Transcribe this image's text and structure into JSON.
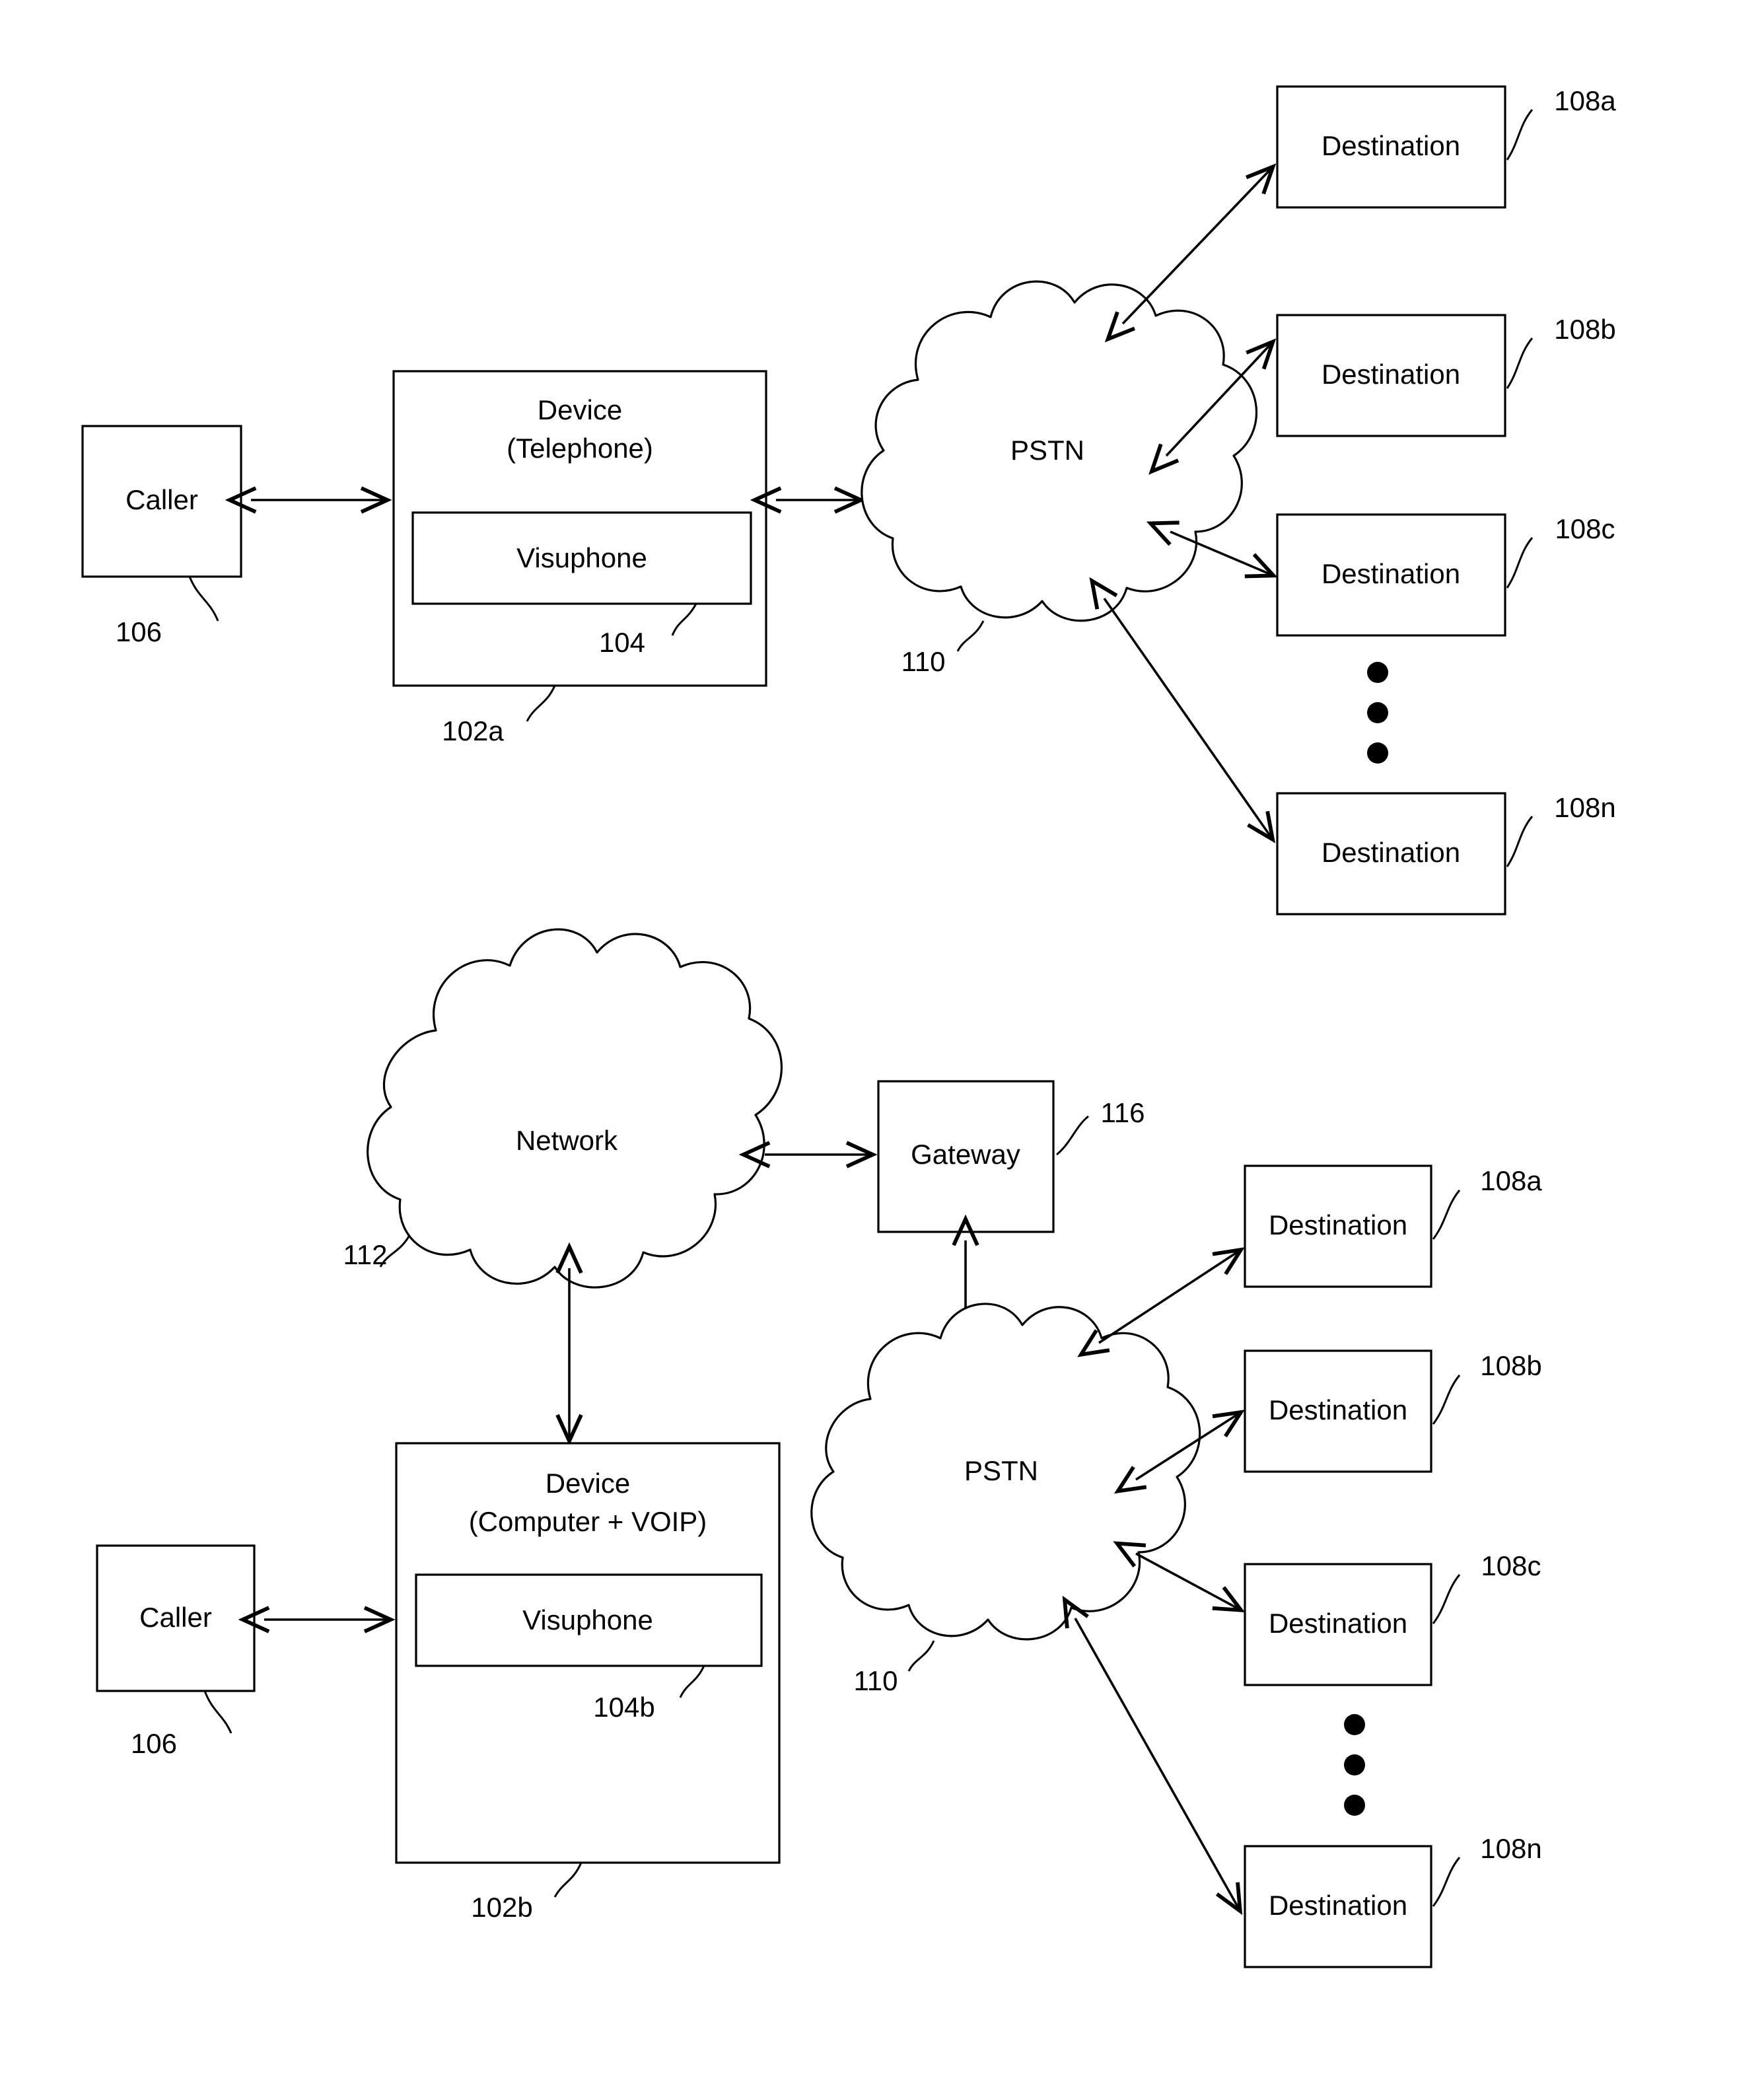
{
  "figure": {
    "type": "patent-diagram",
    "title": "Visuphone call routing system block diagrams",
    "panels": [
      {
        "id": "upper-panel",
        "nodes": {
          "caller": {
            "label": "Caller",
            "ref": "106"
          },
          "device": {
            "label_line1": "Device",
            "label_line2": "(Telephone)",
            "ref": "102a"
          },
          "visuphone": {
            "label": "Visuphone",
            "ref": "104"
          },
          "pstn": {
            "label": "PSTN",
            "ref": "110"
          },
          "destinations": [
            {
              "label": "Destination",
              "ref": "108a"
            },
            {
              "label": "Destination",
              "ref": "108b"
            },
            {
              "label": "Destination",
              "ref": "108c"
            },
            {
              "label": "Destination",
              "ref": "108n"
            }
          ],
          "ellipsis": "vertical-three-dots"
        }
      },
      {
        "id": "lower-panel",
        "nodes": {
          "caller": {
            "label": "Caller",
            "ref": "106"
          },
          "device": {
            "label_line1": "Device",
            "label_line2": "(Computer + VOIP)",
            "ref": "102b"
          },
          "visuphone": {
            "label": "Visuphone",
            "ref": "104b"
          },
          "network": {
            "label": "Network",
            "ref": "112"
          },
          "gateway": {
            "label": "Gateway",
            "ref": "116"
          },
          "pstn": {
            "label": "PSTN",
            "ref": "110"
          },
          "destinations": [
            {
              "label": "Destination",
              "ref": "108a"
            },
            {
              "label": "Destination",
              "ref": "108b"
            },
            {
              "label": "Destination",
              "ref": "108c"
            },
            {
              "label": "Destination",
              "ref": "108n"
            }
          ],
          "ellipsis": "vertical-three-dots"
        }
      }
    ],
    "colors": {
      "ink": "#000000",
      "paper": "#ffffff"
    }
  }
}
